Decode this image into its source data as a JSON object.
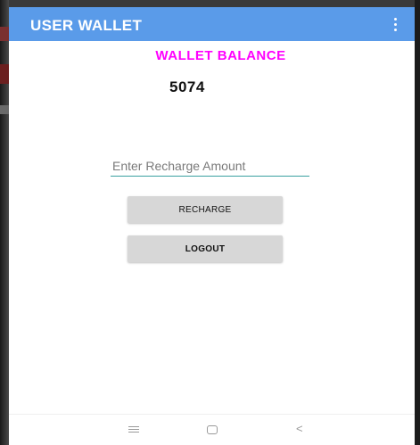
{
  "appbar": {
    "title": "USER WALLET",
    "overflow_icon": "vertical-dots-icon"
  },
  "wallet": {
    "heading": "WALLET BALANCE",
    "balance": "5074"
  },
  "recharge": {
    "placeholder": "Enter Recharge Amount",
    "value": "",
    "button_label": "RECHARGE"
  },
  "logout": {
    "button_label": "LOGOUT"
  },
  "navbar": {
    "recents_icon": "recents-icon",
    "home_icon": "home-icon",
    "back_icon": "back-icon",
    "back_glyph": "<"
  },
  "colors": {
    "appbar": "#5a9be9",
    "heading": "#ff00ff",
    "button": "#d7d7d7",
    "input_underline": "#3aa0a0"
  }
}
